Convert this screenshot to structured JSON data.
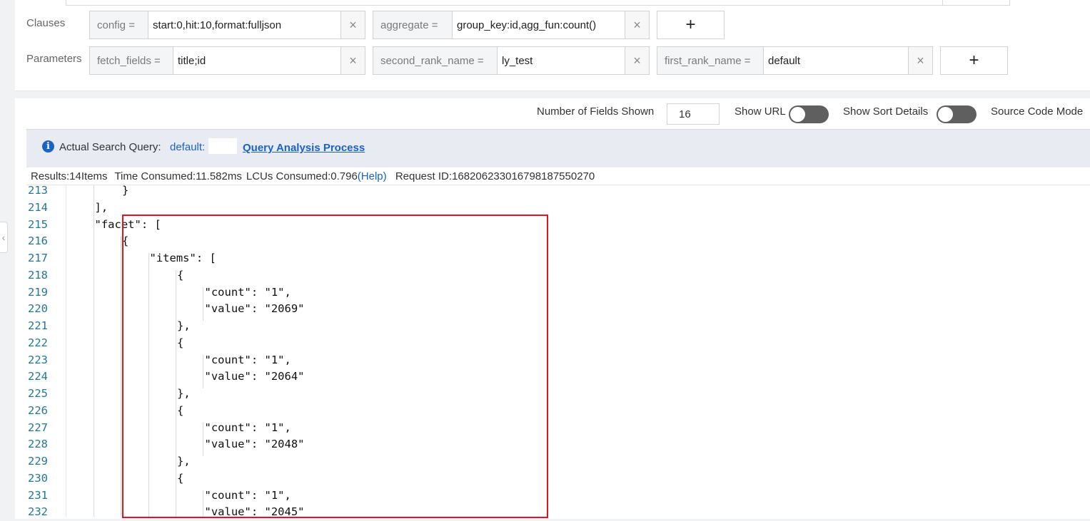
{
  "clauses": {
    "label": "Clauses",
    "items": [
      {
        "key": "config =",
        "value": "start:0,hit:10,format:fulljson"
      },
      {
        "key": "aggregate =",
        "value": "group_key:id,agg_fun:count()"
      }
    ]
  },
  "parameters": {
    "label": "Parameters",
    "items": [
      {
        "key": "fetch_fields =",
        "value": "title;id"
      },
      {
        "key": "second_rank_name =",
        "value": "ly_test"
      },
      {
        "key": "first_rank_name =",
        "value": "default"
      }
    ]
  },
  "icons": {
    "delete": "×",
    "add": "+",
    "info": "i",
    "collapse": "‹"
  },
  "toolbar": {
    "fields_shown_label": "Number of Fields Shown",
    "fields_shown_value": "16",
    "show_url_label": "Show URL",
    "show_url_on": false,
    "show_sort_label": "Show Sort Details",
    "show_sort_on": false,
    "source_mode_label": "Source Code Mode"
  },
  "info": {
    "label": "Actual Search Query:",
    "query": "default:",
    "link": "Query Analysis Process"
  },
  "stats": {
    "results": "Results:14Items",
    "time": "Time Consumed:11.582ms",
    "lcu": "LCUs Consumed:0.796",
    "help": "(Help)",
    "request": "Request ID:168206233016798187550270"
  },
  "code_lines": [
    {
      "n": "213",
      "indent": 4,
      "text": "}"
    },
    {
      "n": "214",
      "indent": 3,
      "text": "],"
    },
    {
      "n": "215",
      "indent": 3,
      "text": "\"facet\": ["
    },
    {
      "n": "216",
      "indent": 4,
      "text": "{"
    },
    {
      "n": "217",
      "indent": 5,
      "text": "\"items\": ["
    },
    {
      "n": "218",
      "indent": 6,
      "text": "{"
    },
    {
      "n": "219",
      "indent": 7,
      "text": "\"count\": \"1\","
    },
    {
      "n": "220",
      "indent": 7,
      "text": "\"value\": \"2069\""
    },
    {
      "n": "221",
      "indent": 6,
      "text": "},"
    },
    {
      "n": "222",
      "indent": 6,
      "text": "{"
    },
    {
      "n": "223",
      "indent": 7,
      "text": "\"count\": \"1\","
    },
    {
      "n": "224",
      "indent": 7,
      "text": "\"value\": \"2064\""
    },
    {
      "n": "225",
      "indent": 6,
      "text": "},"
    },
    {
      "n": "226",
      "indent": 6,
      "text": "{"
    },
    {
      "n": "227",
      "indent": 7,
      "text": "\"count\": \"1\","
    },
    {
      "n": "228",
      "indent": 7,
      "text": "\"value\": \"2048\""
    },
    {
      "n": "229",
      "indent": 6,
      "text": "},"
    },
    {
      "n": "230",
      "indent": 6,
      "text": "{"
    },
    {
      "n": "231",
      "indent": 7,
      "text": "\"count\": \"1\","
    },
    {
      "n": "232",
      "indent": 7,
      "text": "\"value\": \"2045\""
    }
  ],
  "colors": {
    "link": "#1a62c6",
    "line_number": "#237893",
    "highlight": "#e5131d",
    "toggle_off": "#5f5f5f"
  }
}
